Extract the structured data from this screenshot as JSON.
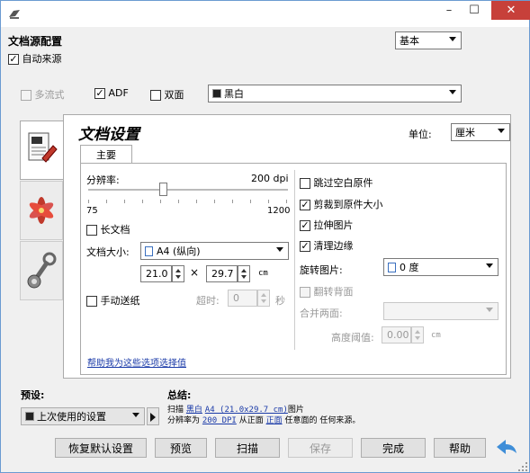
{
  "window": {
    "min_icon": "minimize-icon",
    "max_icon": "maximize-icon",
    "close_icon": "close-icon",
    "accent": "#c7403a"
  },
  "source": {
    "title": "文档源配置",
    "mode_value": "基本",
    "auto_source_label": "自动来源",
    "multistream_label": "多流式",
    "adf_label": "ADF",
    "duplex_label": "双面",
    "color_mode_value": "黑白"
  },
  "doc": {
    "title": "文档设置",
    "tab_main": "主要",
    "unit_label": "单位:",
    "unit_value": "厘米",
    "resolution_label": "分辨率:",
    "resolution_value": "200 dpi",
    "resolution_fraction": 0.1,
    "res_min": "75",
    "res_max": "1200",
    "long_doc_label": "长文档",
    "size_label": "文档大小:",
    "size_value": "A4 (纵向)",
    "width": "21.0",
    "times": "×",
    "height": "29.7",
    "size_unit": "cm",
    "manual_feed_label": "手动送纸",
    "timeout_label": "超时:",
    "timeout_value": "0",
    "timeout_unit": "秒",
    "help_link": "帮助我为这些选项选择值",
    "skip_blank_label": "跳过空白原件",
    "crop_label": "剪裁到原件大小",
    "stretch_label": "拉伸图片",
    "clean_edges_label": "清理边缘",
    "rotate_label": "旋转图片:",
    "rotate_value": "0 度",
    "flip_label": "翻转背面",
    "merge_label": "合并两面:",
    "merge_value": "",
    "threshold_label": "高度阈值:",
    "threshold_value": "0.00",
    "threshold_unit": "cm"
  },
  "preset": {
    "label": "预设:",
    "value": "上次使用的设置"
  },
  "summary": {
    "label": "总结:",
    "line1_a": "扫描",
    "line1_link1": "黑白",
    "line1_link2": "A4 (21.0x29.7 cm)",
    "line1_b": "图片",
    "line2_a": "分辨率为",
    "line2_link1": "200 DPI",
    "line2_b": "从正面",
    "line2_link2": "正面",
    "line2_c": "任意面的 任何来源。"
  },
  "buttons": {
    "reset": "恢复默认设置",
    "preview": "预览",
    "scan": "扫描",
    "save": "保存",
    "done": "完成",
    "help": "帮助"
  }
}
